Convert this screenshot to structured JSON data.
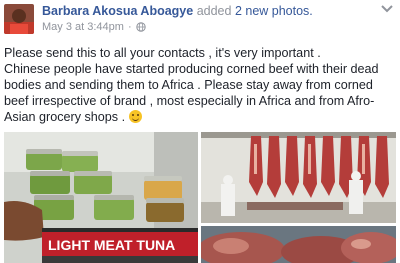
{
  "post": {
    "author_name": "Barbara Akosua Aboagye",
    "action_text": "added",
    "photo_count_text": "2 new photos.",
    "timestamp": "May 3 at 3:44pm",
    "message_lines": [
      "Please send this to all your contacts , it's very important .",
      "Chinese people have started producing corned beef with their dead bodies and sending them to Africa . Please stay away from corned beef irrespective of brand , most especially in Africa and from Afro-Asian grocery shops ."
    ],
    "emoji": "slightly-smiling-face"
  },
  "photos": {
    "photo_1": {
      "can_label": "LIGHT MEAT TUNA"
    }
  },
  "icons": {
    "privacy": "globe-icon",
    "menu": "chevron-down-icon"
  },
  "colors": {
    "link": "#365899",
    "meta": "#90949c",
    "text": "#1d2129"
  }
}
